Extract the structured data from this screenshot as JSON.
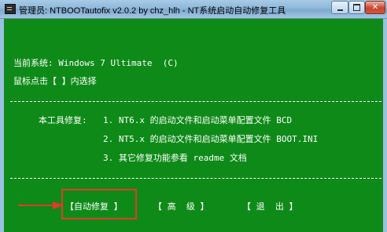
{
  "window": {
    "title": "管理员: NTBOOTautofix v2.0.2 by chz_hlh - NT系统启动自动修复工具",
    "controls": {
      "minimize": "–",
      "maximize": "□",
      "close": "✕"
    }
  },
  "console": {
    "current_system": "当前系统: Windows 7 Ultimate  (C)",
    "prompt": "鼠标点击【 】内选择",
    "separator": "------------------------------------------------------------------------------",
    "fix_intro": "本工具修复:",
    "items": [
      "1. NT6.x 的启动文件和启动菜单配置文件 BCD",
      "2. NT5.x 的启动文件和启动菜单配置文件 BOOT.INI",
      "3. 其它修复功能参看 readme 文档"
    ],
    "buttons": {
      "auto_fix": "【自动修复 】",
      "advanced": "【 高  级 】",
      "exit": "【 退  出 】"
    }
  },
  "colors": {
    "console_bg": "#0e8a18",
    "console_text": "#ffffff",
    "highlight": "#e23b2a"
  }
}
